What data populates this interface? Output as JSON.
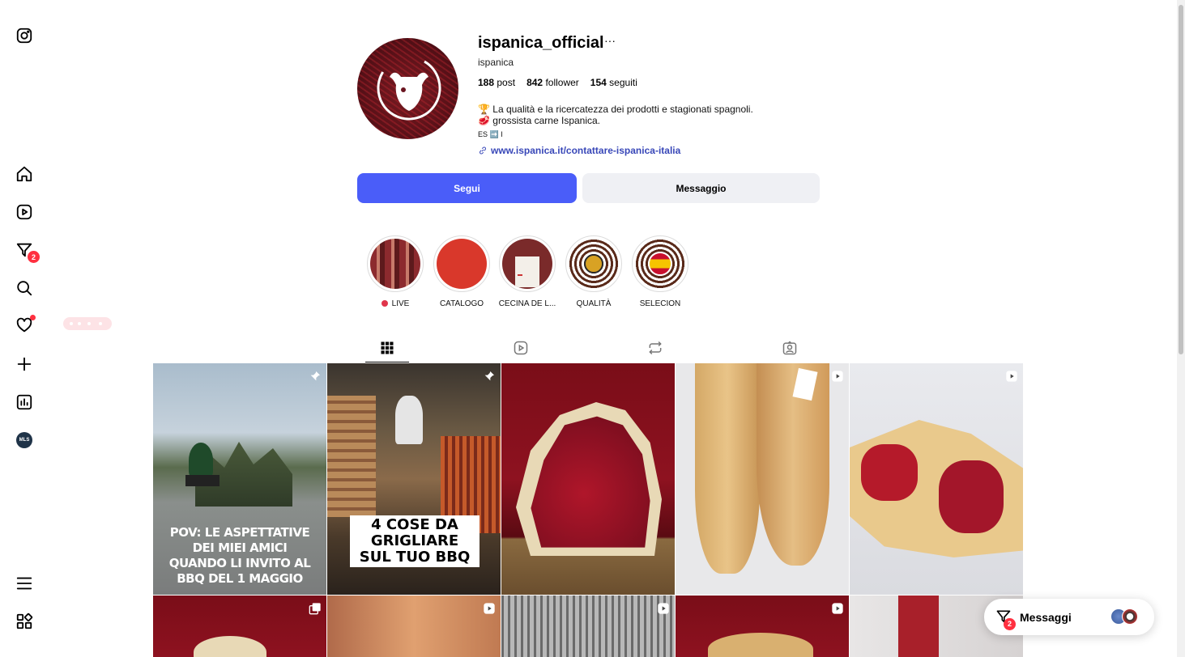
{
  "sidebar": {
    "items": [
      {
        "name": "instagram",
        "icon": "instagram-icon"
      },
      {
        "name": "home",
        "icon": "home-icon"
      },
      {
        "name": "reels",
        "icon": "reels-icon"
      },
      {
        "name": "messages",
        "icon": "messages-icon",
        "badge": "2"
      },
      {
        "name": "search",
        "icon": "search-icon"
      },
      {
        "name": "notifications",
        "icon": "heart-icon"
      },
      {
        "name": "create",
        "icon": "plus-icon"
      },
      {
        "name": "dashboard",
        "icon": "chart-icon"
      },
      {
        "name": "profile",
        "icon": "avatar-icon",
        "avatar_text": "MLS"
      },
      {
        "name": "menu",
        "icon": "hamburger-icon"
      },
      {
        "name": "also-from-meta",
        "icon": "grid-icon"
      }
    ]
  },
  "profile": {
    "username": "ispanica_official",
    "more": "···",
    "full_name": "ispanica",
    "stats": {
      "posts_count": "188",
      "posts_label": "post",
      "followers_count": "842",
      "followers_label": "follower",
      "following_count": "154",
      "following_label": "seguiti"
    },
    "bio_lines": [
      "🏆 La qualità e la ricercatezza dei prodotti e stagionati spagnoli.",
      "🥩 grossista carne Ispanica.",
      "ES ➡️ I"
    ],
    "link": "www.ispanica.it/contattare-ispanica-italia",
    "follow_label": "Segui",
    "message_label": "Messaggio"
  },
  "highlights": [
    {
      "label": "LIVE",
      "live": true
    },
    {
      "label": "CATALOGO"
    },
    {
      "label": "CECINA DE L..."
    },
    {
      "label": "QUALITÀ"
    },
    {
      "label": "SELECION"
    }
  ],
  "tabs": [
    {
      "name": "posts",
      "icon": "grid-icon",
      "active": true
    },
    {
      "name": "reels",
      "icon": "reels-icon"
    },
    {
      "name": "reposts",
      "icon": "repost-icon"
    },
    {
      "name": "tagged",
      "icon": "tagged-icon"
    }
  ],
  "grid": {
    "captions": {
      "post1": "POV: LE ASPETTATIVE DEI MIEI AMICI QUANDO LI INVITO AL BBQ DEL 1 MAGGIO",
      "post2": "4 COSE DA GRIGLIARE SUL TUO BBQ"
    },
    "tiles": [
      {
        "type": "pinned"
      },
      {
        "type": "pinned"
      },
      {
        "type": "image"
      },
      {
        "type": "reel"
      },
      {
        "type": "reel"
      },
      {
        "type": "carousel"
      },
      {
        "type": "reel"
      },
      {
        "type": "reel"
      },
      {
        "type": "reel"
      },
      {
        "type": "image"
      }
    ]
  },
  "messages_widget": {
    "label": "Messaggi",
    "badge": "2"
  },
  "colors": {
    "accent": "#4a5df9",
    "badge": "#ff3040",
    "link": "#3847b8"
  }
}
